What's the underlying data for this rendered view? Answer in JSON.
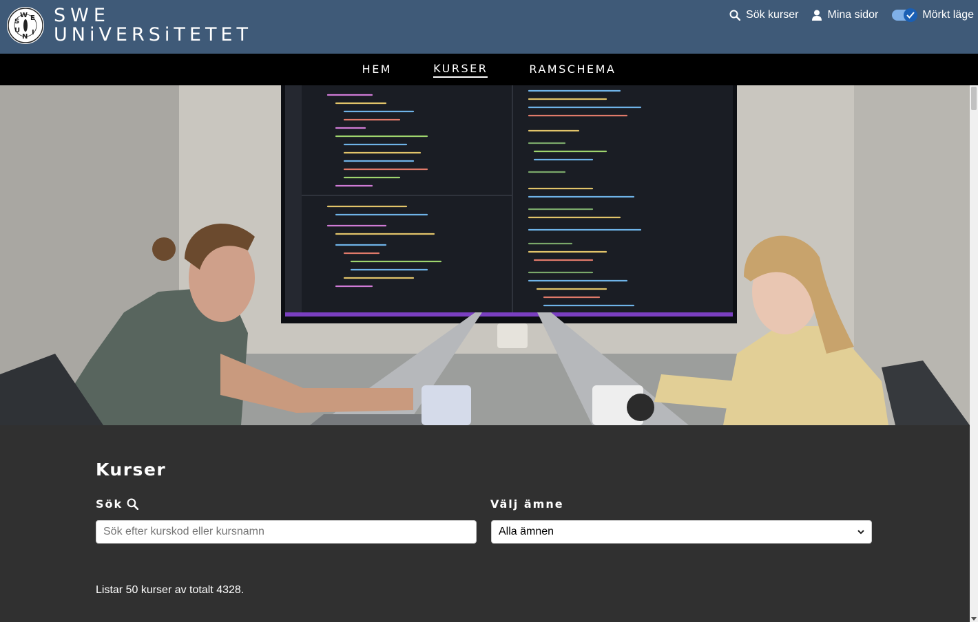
{
  "header": {
    "logo_line1": "SWE",
    "logo_line2": "UNiVERSiTETET",
    "seal_letters": "SWEUNI",
    "search_link": "Sök kurser",
    "my_pages_link": "Mina sidor",
    "dark_mode_label": "Mörkt läge",
    "dark_mode_on": true
  },
  "nav": {
    "items": [
      {
        "label": "HEM",
        "active": false
      },
      {
        "label": "KURSER",
        "active": true
      },
      {
        "label": "RAMSCHEMA",
        "active": false
      }
    ]
  },
  "hero": {
    "description_visible": false
  },
  "main": {
    "title": "Kurser",
    "search_label": "Sök",
    "search_placeholder": "Sök efter kurskod eller kursnamn",
    "search_value": "",
    "subject_label": "Välj ämne",
    "subject_selected": "Alla ämnen",
    "result_text": "Listar 50 kurser av totalt 4328."
  },
  "colors": {
    "header_bg": "#3f5a78",
    "nav_bg": "#000000",
    "content_bg": "#303030",
    "toggle_accent": "#1a5fb4"
  },
  "icons": [
    "search-icon",
    "user-icon",
    "check-icon",
    "chevron-down-icon"
  ]
}
